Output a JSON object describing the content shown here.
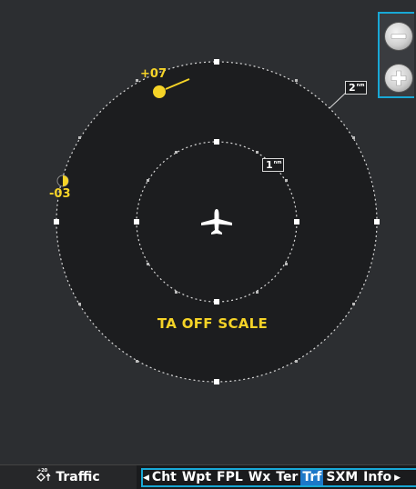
{
  "map": {
    "outer_range_label": "2",
    "outer_range_unit": "nm",
    "inner_range_label": "1",
    "inner_range_unit": "nm",
    "status_message": "TA OFF SCALE"
  },
  "traffic": [
    {
      "altitude_label": "+07",
      "color": "#f5d327",
      "symbol": "traffic-advisory-circle"
    },
    {
      "altitude_label": "-03",
      "color": "#f5d327",
      "symbol": "traffic-advisory-half-circle"
    }
  ],
  "zoom": {
    "out_icon": "minus-icon",
    "in_icon": "plus-icon"
  },
  "bottom_bar": {
    "page_title": "Traffic",
    "page_icon": "traffic-icon",
    "tabs": [
      "Cht",
      "Wpt",
      "FPL",
      "Wx",
      "Ter",
      "Trf",
      "SXM",
      "Info"
    ],
    "active_tab": "Trf"
  },
  "colors": {
    "background": "#2c2e31",
    "accent": "#18a8d6",
    "traffic": "#f5d327",
    "active_tab": "#1d78c8"
  }
}
